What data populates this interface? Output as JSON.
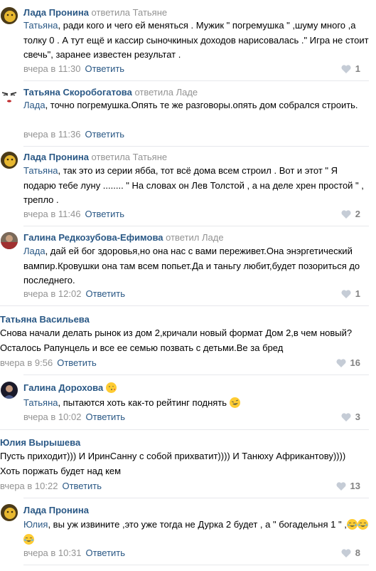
{
  "comments": [
    {
      "author": "Лада Пронина",
      "replied": "ответила Татьяне",
      "mention": "Татьяна",
      "text": ", ради кого и чего ей меняться . Мужик \" погремушка \" ,шуму много ,а толку 0 . А тут ещё и кассир сыночкиных доходов нарисовалась .\" Игра не стоит свечь\", заранее известен результат .",
      "date": "вчера в 11:30",
      "reply": "Ответить",
      "likes": "1"
    },
    {
      "author": "Татьяна Скоробогатова",
      "replied": "ответила Ладе",
      "mention": "Лада",
      "text": ", точно погремушка.Опять те же разговоры.опять дом собрался строить.",
      "date": "вчера в 11:36",
      "reply": "Ответить",
      "likes": ""
    },
    {
      "author": "Лада Пронина",
      "replied": "ответила Татьяне",
      "mention": "Татьяна",
      "text": ", так это из серии ябба, тот всё дома всем строил . Вот и этот \" Я подарю тебе луну ........ \" На словах он Лев Толстой , а на деле хрен простой \" , трепло .",
      "date": "вчера в 11:46",
      "reply": "Ответить",
      "likes": "2"
    },
    {
      "author": "Галина Редкозубова-Ефимова",
      "replied": "ответил Ладе",
      "mention": "Лада",
      "text": ", дай ей бог здоровья,но она нас с вами переживет.Она энэргетический вампир.Кровушки она там всем попьет.Да и таньгу любит,будет позориться до последнего.",
      "date": "вчера в 12:02",
      "reply": "Ответить",
      "likes": "1"
    },
    {
      "author": "Татьяна Васильева",
      "replied": "",
      "mention": "",
      "text": "Снова начали делать рынок из дом 2,кричали новый формат Дом 2,в чем новый?Осталось Рапунцель и все ее семью позвать с детьми.Ве за бред",
      "date": "вчера в 9:56",
      "reply": "Ответить",
      "likes": "16"
    },
    {
      "author": "Галина Дорохова",
      "replied": "",
      "mention": "Татьяна",
      "text": ", пытаются хоть как-то рейтинг поднять",
      "date": "вчера в 10:02",
      "reply": "Ответить",
      "likes": "3"
    },
    {
      "author": "Юлия Вырышева",
      "replied": "",
      "mention": "",
      "text": "Пусть приходит))) И ИринСанну с собой прихватит)))) И Танюху Африкантову)))) Хоть поржать будет над кем",
      "date": "вчера в 10:22",
      "reply": "Ответить",
      "likes": "13"
    },
    {
      "author": "Лада Пронина",
      "replied": "",
      "mention": "Юлия",
      "text": ", вы уж извините ,это уже тогда не Дурка 2 будет , а \" богадельня 1 \" ,",
      "date": "вчера в 10:31",
      "reply": "Ответить",
      "likes": "8"
    }
  ],
  "colors": {
    "link": "#2a5885",
    "meta": "#939393",
    "like": "#828282"
  },
  "icons": {
    "like": "heart-icon",
    "emoji_kiss": "kiss-emoji",
    "emoji_rofl": "rofl-emoji",
    "emoji_joy": "joy-emoji"
  }
}
